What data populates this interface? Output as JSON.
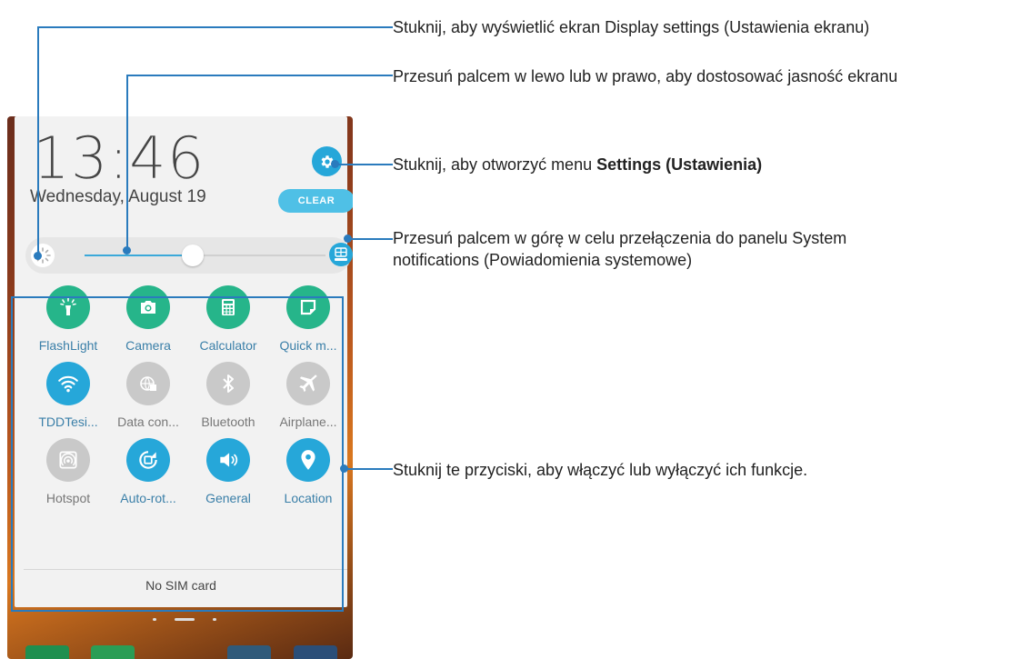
{
  "notification_panel": {
    "time": "13:46",
    "date": "Wednesday, August 19",
    "clear_label": "CLEAR",
    "settings_icon": "gear-icon",
    "brightness_level": 0.45,
    "no_sim": "No SIM card",
    "tiles": [
      {
        "label": "FlashLight",
        "icon": "flashlight-icon",
        "state": "green"
      },
      {
        "label": "Camera",
        "icon": "camera-icon",
        "state": "green"
      },
      {
        "label": "Calculator",
        "icon": "calculator-icon",
        "state": "green"
      },
      {
        "label": "Quick m...",
        "icon": "quick-memo-icon",
        "state": "green"
      },
      {
        "label": "TDDTesi...",
        "icon": "wifi-icon",
        "state": "blue"
      },
      {
        "label": "Data con...",
        "icon": "globe-icon",
        "state": "gray"
      },
      {
        "label": "Bluetooth",
        "icon": "bluetooth-icon",
        "state": "gray"
      },
      {
        "label": "Airplane...",
        "icon": "airplane-icon",
        "state": "gray"
      },
      {
        "label": "Hotspot",
        "icon": "hotspot-icon",
        "state": "gray"
      },
      {
        "label": "Auto-rot...",
        "icon": "rotate-icon",
        "state": "blue"
      },
      {
        "label": "General",
        "icon": "volume-icon",
        "state": "blue"
      },
      {
        "label": "Location",
        "icon": "location-icon",
        "state": "blue"
      }
    ]
  },
  "callouts": {
    "display_settings": "Stuknij, aby wyświetlić ekran Display settings (Ustawienia ekranu)",
    "brightness": "Przesuń palcem w lewo lub w prawo, aby dostosować jasność ekranu",
    "settings_prefix": "Stuknij, aby otworzyć menu ",
    "settings_bold": "Settings (Ustawienia)",
    "system_notifications_line1": "Przesuń palcem w górę w celu przełączenia do panelu System",
    "system_notifications_line2": "notifications (Powiadomienia systemowe)",
    "toggle_buttons": "Stuknij te przyciski, aby włączyć lub wyłączyć ich funkcje."
  },
  "colors": {
    "accent": "#26a7d9",
    "green": "#26b58a",
    "callout_line": "#2a7bbd"
  }
}
